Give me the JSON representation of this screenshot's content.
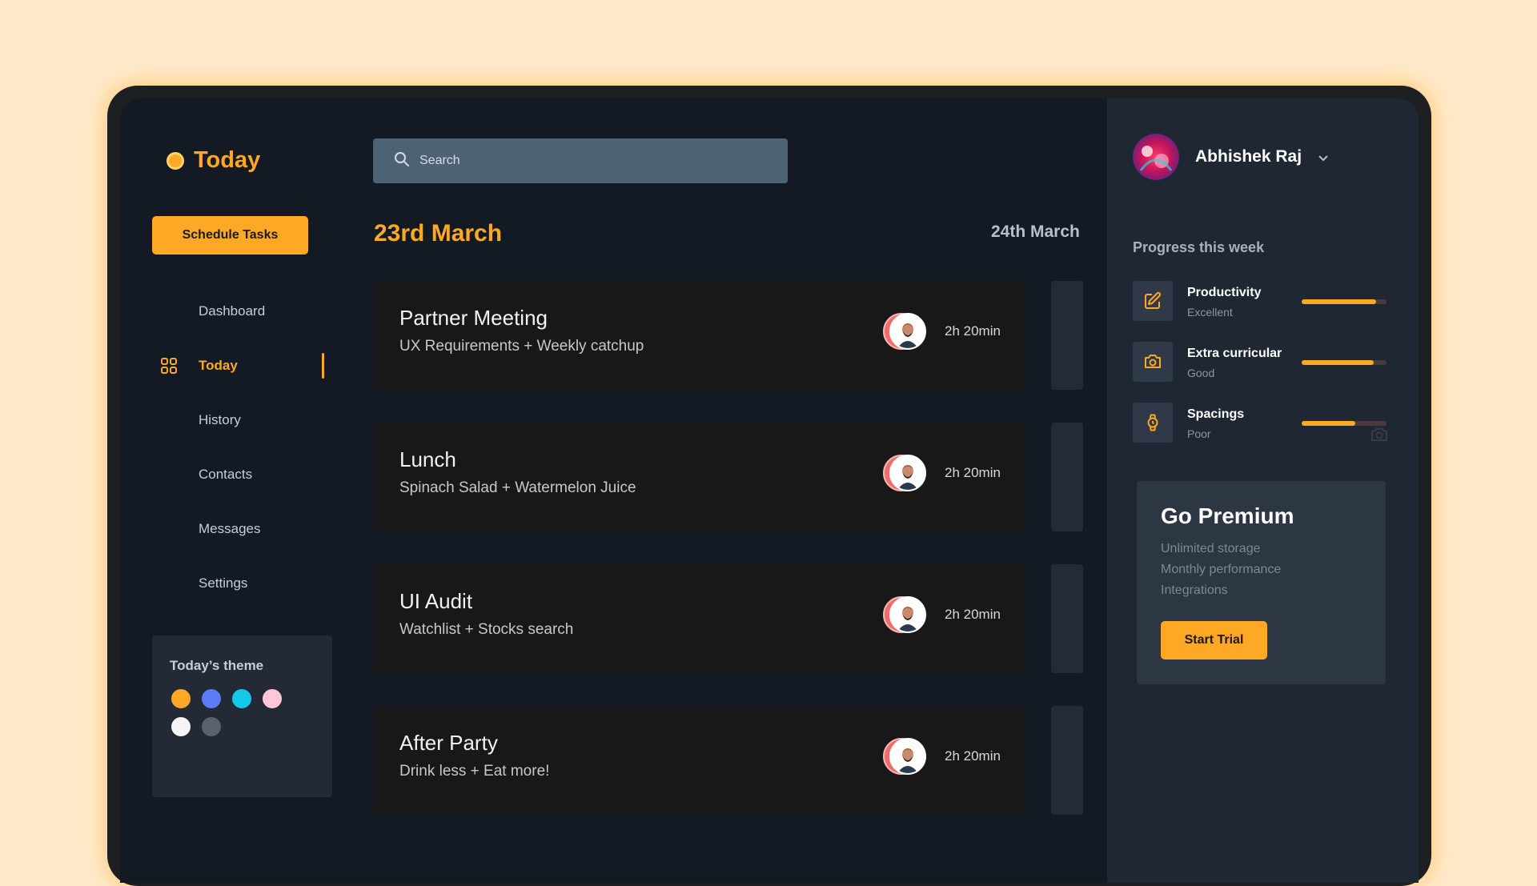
{
  "brand": {
    "title": "Today"
  },
  "sidebar": {
    "schedule_button": "Schedule Tasks",
    "items": [
      {
        "label": "Dashboard"
      },
      {
        "label": "Today",
        "icon": "grid-icon"
      },
      {
        "label": "History"
      },
      {
        "label": "Contacts"
      },
      {
        "label": "Messages"
      },
      {
        "label": "Settings"
      }
    ],
    "theme": {
      "title": "Today’s theme",
      "colors": [
        "#FFA825",
        "#5B7CF5",
        "#14C8E8",
        "#FFC7D5",
        "#F5F5F7",
        "#5A616D"
      ]
    }
  },
  "search": {
    "placeholder": "Search"
  },
  "main": {
    "date_current": "23rd March",
    "date_next": "24th March",
    "tasks": [
      {
        "title": "Partner Meeting",
        "subtitle": "UX Requirements + Weekly catchup",
        "duration": "2h 20min"
      },
      {
        "title": "Lunch",
        "subtitle": "Spinach Salad + Watermelon Juice",
        "duration": "2h 20min"
      },
      {
        "title": "UI Audit",
        "subtitle": "Watchlist + Stocks search",
        "duration": "2h 20min"
      },
      {
        "title": "After Party",
        "subtitle": "Drink less + Eat more!",
        "duration": "2h 20min"
      }
    ]
  },
  "profile": {
    "name": "Abhishek Raj"
  },
  "progress": {
    "title": "Progress this week",
    "items": [
      {
        "label": "Productivity",
        "rating": "Excellent",
        "icon": "edit-icon",
        "percent": 88
      },
      {
        "label": "Extra curricular",
        "rating": "Good",
        "icon": "camera-icon",
        "percent": 85
      },
      {
        "label": "Spacings",
        "rating": "Poor",
        "icon": "watch-icon",
        "percent": 63
      }
    ]
  },
  "premium": {
    "title": "Go Premium",
    "features": [
      "Unlimited storage",
      "Monthly performance",
      "Integrations"
    ],
    "button": "Start Trial"
  },
  "colors": {
    "accent": "#FFA825",
    "background": "#141A24",
    "panel": "#1F2733"
  }
}
